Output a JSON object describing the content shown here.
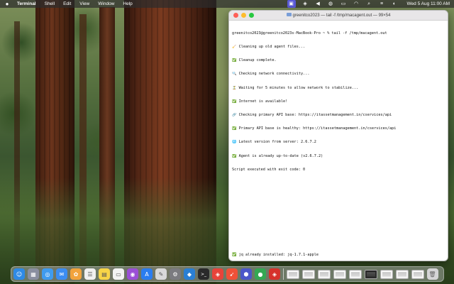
{
  "menubar": {
    "app_name": "Terminal",
    "items": [
      "Shell",
      "Edit",
      "View",
      "Window",
      "Help"
    ],
    "clock": "Wed 5 Aug  11:00 AM"
  },
  "terminal": {
    "title": "greenitco2023 — tail -f /tmp/macagent.out — 99×54",
    "lines": [
      "greenitco2023@greenitco2023s-MacBook-Pro ~ % tail -f /tmp/macagent.out",
      "🧹 Cleaning up old agent files...",
      "✅ Cleanup complete.",
      "🔍 Checking network connectivity...",
      "⏳ Waiting for 5 minutes to allow network to stabilize...",
      "✅ Internet is available!",
      "🔗 Checking primary API base: https://itassetmanagement.in/cservices/api",
      "✅ Primary API base is healthy: https://itassetmanagement.in/cservices/api",
      "🌐 Latest version from server: 2.6.7.2",
      "✅ Agent is already up-to-date (v2.6.7.2)",
      "Script executed with exit code: 0"
    ],
    "bottom_line": "✅ jq already installed: jq-1.7.1-apple"
  },
  "dock": {
    "apps": [
      {
        "name": "finder-icon",
        "glyph": "☺",
        "color": "#2e8ae6"
      },
      {
        "name": "launchpad-icon",
        "glyph": "▦",
        "color": "#8a8fa0"
      },
      {
        "name": "safari-icon",
        "glyph": "◎",
        "color": "#3f9bf0"
      },
      {
        "name": "mail-icon",
        "glyph": "✉",
        "color": "#3c8df2"
      },
      {
        "name": "photos-icon",
        "glyph": "✿",
        "color": "#f2a33c"
      },
      {
        "name": "reminders-icon",
        "glyph": "☰",
        "color": "#f0f0f0"
      },
      {
        "name": "notes-icon",
        "glyph": "▤",
        "color": "#f7d447"
      },
      {
        "name": "calendar-icon",
        "glyph": "▭",
        "color": "#f3f3f3"
      },
      {
        "name": "podcasts-icon",
        "glyph": "◉",
        "color": "#9b4fd6"
      },
      {
        "name": "app-store-icon",
        "glyph": "A",
        "color": "#2a7df0"
      },
      {
        "name": "sketch-pad-icon",
        "glyph": "✎",
        "color": "#d9d9d9"
      },
      {
        "name": "system-settings-icon",
        "glyph": "⚙",
        "color": "#7b7b80"
      },
      {
        "name": "vscode-icon",
        "glyph": "◆",
        "color": "#2a7fd4"
      },
      {
        "name": "terminal-icon",
        "glyph": ">_",
        "color": "#2a2a2a"
      },
      {
        "name": "anydesk-icon",
        "glyph": "◈",
        "color": "#e8433a"
      },
      {
        "name": "swift-icon",
        "glyph": "➹",
        "color": "#f05138"
      },
      {
        "name": "shield-app-icon",
        "glyph": "⬢",
        "color": "#4b57c9"
      },
      {
        "name": "chrome-icon",
        "glyph": "●",
        "color": "#34a853"
      },
      {
        "name": "anydesk-alt-icon",
        "glyph": "◈",
        "color": "#d6312b"
      }
    ],
    "thumbnails": [
      "light",
      "light",
      "light",
      "light",
      "light",
      "dark",
      "light",
      "light",
      "light"
    ],
    "trash_label": "trash-icon"
  }
}
